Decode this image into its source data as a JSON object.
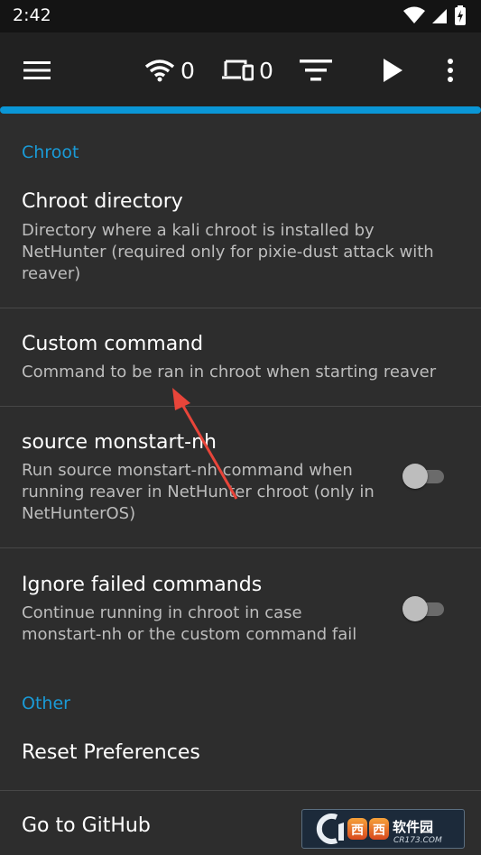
{
  "status_bar": {
    "time": "2:42",
    "icons": [
      "wifi-icon",
      "signal-icon",
      "battery-icon"
    ]
  },
  "toolbar": {
    "wifi_count": "0",
    "device_count": "0",
    "icons": [
      "menu-icon",
      "wifi-icon",
      "devices-icon",
      "sort-icon",
      "play-icon",
      "overflow-menu-icon"
    ]
  },
  "colors": {
    "accent": "#1a9ad6",
    "background": "#2d2d2d",
    "toolbar": "#212121",
    "status_bar": "#141414"
  },
  "categories": {
    "chroot": "Chroot",
    "other": "Other"
  },
  "prefs": {
    "chroot_directory": {
      "title": "Chroot directory",
      "summary_lines": [
        "Directory where a kali chroot is installed by",
        "NetHunter (required only for pixie-dust attack with",
        "reaver)"
      ]
    },
    "custom_command": {
      "title": "Custom command",
      "summary": "Command to be ran in chroot when starting reaver"
    },
    "source_monstart": {
      "title": "source monstart-nh",
      "summary_lines": [
        "Run source monstart-nh command when",
        "running reaver in NetHunter chroot (only in",
        "NetHunterOS)"
      ],
      "enabled": false
    },
    "ignore_failed": {
      "title": "Ignore failed commands",
      "summary_lines": [
        "Continue running in chroot in case",
        "monstart-nh or the custom command fail"
      ],
      "enabled": false
    },
    "reset_preferences": {
      "title": "Reset Preferences"
    },
    "go_to_github": {
      "title": "Go to GitHub"
    }
  },
  "watermark": {
    "brand": "西西软件园",
    "url": "CR173.COM"
  }
}
